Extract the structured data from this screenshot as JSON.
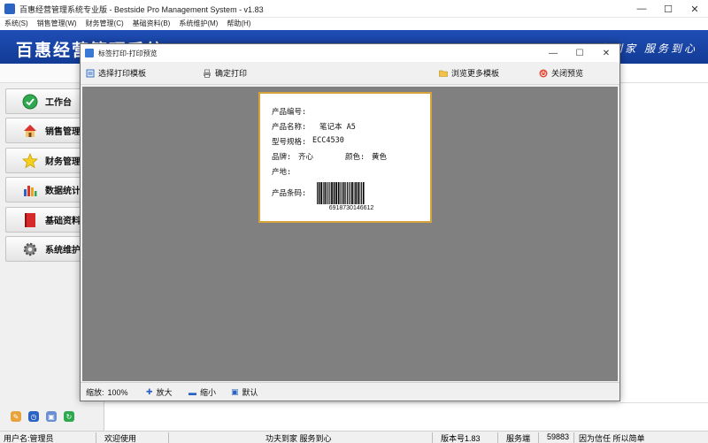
{
  "main_window": {
    "title": "百惠经营管理系统专业版 - Bestside Pro Management System - v1.83",
    "controls": {
      "minimize": "—",
      "maximize": "☐",
      "close": "✕"
    }
  },
  "menu": [
    "系统(S)",
    "销售管理(W)",
    "财务管理(C)",
    "基础资料(B)",
    "系统维护(M)",
    "帮助(H)"
  ],
  "banner": {
    "title": "百惠经营管理系统",
    "slogan": "功夫到家 服务到心"
  },
  "sidebar": {
    "items": [
      {
        "label": "工作台",
        "icon": "check-circle-icon"
      },
      {
        "label": "销售管理",
        "icon": "house-icon"
      },
      {
        "label": "财务管理",
        "icon": "star-icon"
      },
      {
        "label": "数据统计",
        "icon": "bar-chart-icon"
      },
      {
        "label": "基础资料",
        "icon": "book-icon"
      },
      {
        "label": "系统维护",
        "icon": "gear-icon"
      }
    ]
  },
  "dialog": {
    "title": "标签打印-打印预览",
    "toolbar": {
      "select_template": "选择打印模板",
      "confirm_print": "确定打印",
      "browse_templates": "浏览更多模板",
      "close_preview": "关闭预览"
    },
    "bottom": {
      "zoom_label": "缩放:",
      "zoom_value": "100%",
      "zoom_in": "放大",
      "zoom_out": "缩小",
      "default": "默认"
    },
    "controls": {
      "minimize": "—",
      "maximize": "☐",
      "close": "✕"
    }
  },
  "label": {
    "product_code_label": "产品编号:",
    "product_name_label": "产品名称:",
    "product_name_value": "笔记本 A5",
    "model_label": "型号规格:",
    "model_value": "ECC4530",
    "brand_label": "品牌:",
    "brand_value": "齐心",
    "color_label": "颜色:",
    "color_value": "黄色",
    "origin_label": "产地:",
    "barcode_label": "产品条码:",
    "barcode_value": "6918730146612"
  },
  "status": {
    "user": "用户名:管理员",
    "welcome": "欢迎使用",
    "motto": "功夫到家 服务到心",
    "version": "版本号1.83",
    "service": "服务端",
    "code": "59883",
    "slogan": "因为信任 所以简单"
  },
  "colors": {
    "banner": "#1f4db5",
    "preview_bg": "#808080",
    "label_border": "#d6a33a"
  }
}
